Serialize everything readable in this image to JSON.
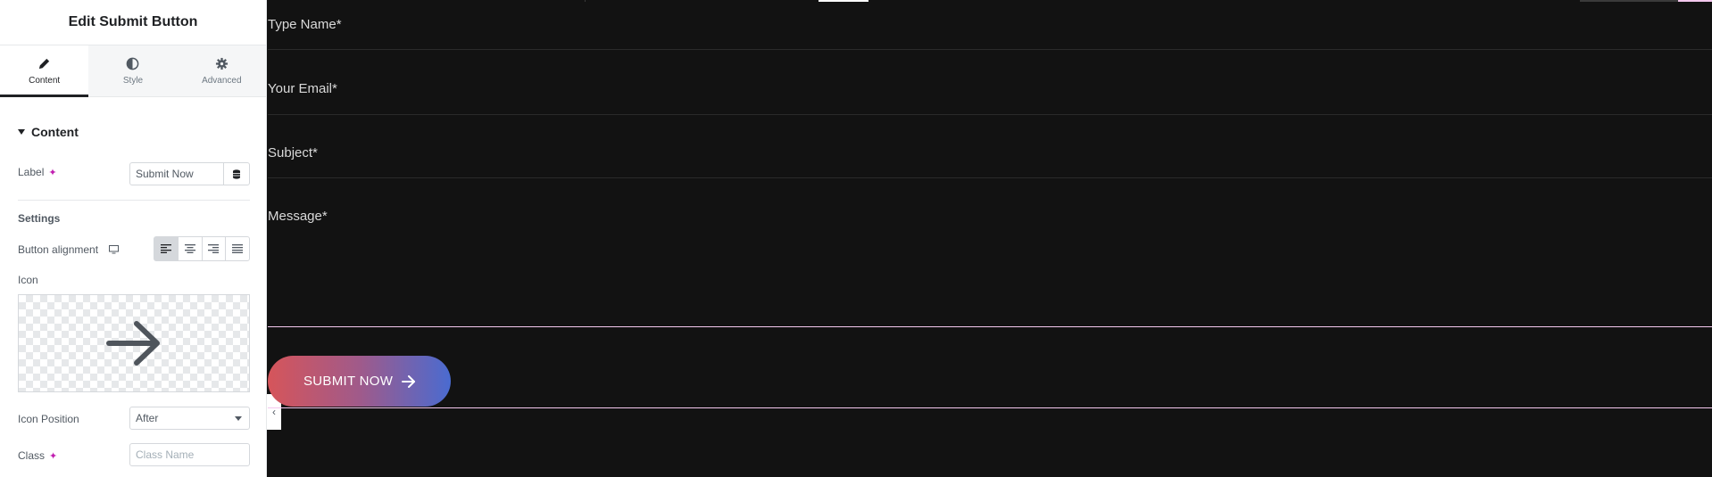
{
  "panel": {
    "title": "Edit Submit Button",
    "tabs": [
      {
        "label": "Content",
        "icon": "pencil-icon",
        "active": true
      },
      {
        "label": "Style",
        "icon": "half-circle-icon",
        "active": false
      },
      {
        "label": "Advanced",
        "icon": "gear-icon",
        "active": false
      }
    ],
    "section_title": "Content",
    "label_field": {
      "label": "Label",
      "value": "Submit Now"
    },
    "settings_heading": "Settings",
    "alignment": {
      "label": "Button alignment",
      "options": [
        "left",
        "center",
        "right",
        "justify"
      ],
      "selected": "left"
    },
    "icon_field": {
      "label": "Icon",
      "icon": "arrow-right-icon"
    },
    "icon_position": {
      "label": "Icon Position",
      "value": "After"
    },
    "class_field": {
      "label": "Class",
      "placeholder": "Class Name"
    }
  },
  "form": {
    "fields": [
      "Type Name*",
      "Your Email*",
      "Subject*",
      "Message*"
    ],
    "submit_label": "SUBMIT NOW"
  },
  "colors": {
    "ai_accent": "#c11fb0",
    "canvas_bg": "#121212",
    "selection_outline": "#f4c8ee"
  }
}
